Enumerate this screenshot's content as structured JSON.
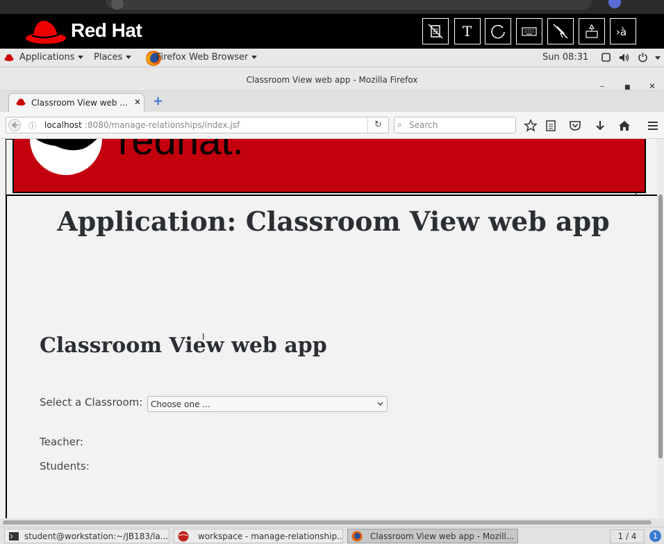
{
  "header": {
    "brand": "Red Hat"
  },
  "gnome_bar": {
    "applications": "Applications",
    "places": "Places",
    "browser": "Firefox Web Browser",
    "clock": "Sun 08:31"
  },
  "firefox": {
    "window_title": "Classroom View web app - Mozilla Firefox",
    "tab_title": "Classroom View web ...",
    "url_host": "localhost",
    "url_rest": ":8080/manage-relationships/index.jsf",
    "search_placeholder": "Search"
  },
  "page": {
    "app_title": "Application: Classroom View web app",
    "section_title": "Classroom View web app",
    "select_label": "Select a Classroom:",
    "select_value": "Choose one ...",
    "teacher_label": "Teacher:",
    "students_label": "Students:"
  },
  "taskbar": {
    "terminal": "student@workstation:~/JB183/la...",
    "workspace": "workspace - manage-relationship...",
    "firefox": "Classroom View web app - Mozill...",
    "pager": "1 / 4",
    "notifications": "1"
  },
  "colors": {
    "banner_red": "#c3000e",
    "redhat_red": "#e00"
  }
}
